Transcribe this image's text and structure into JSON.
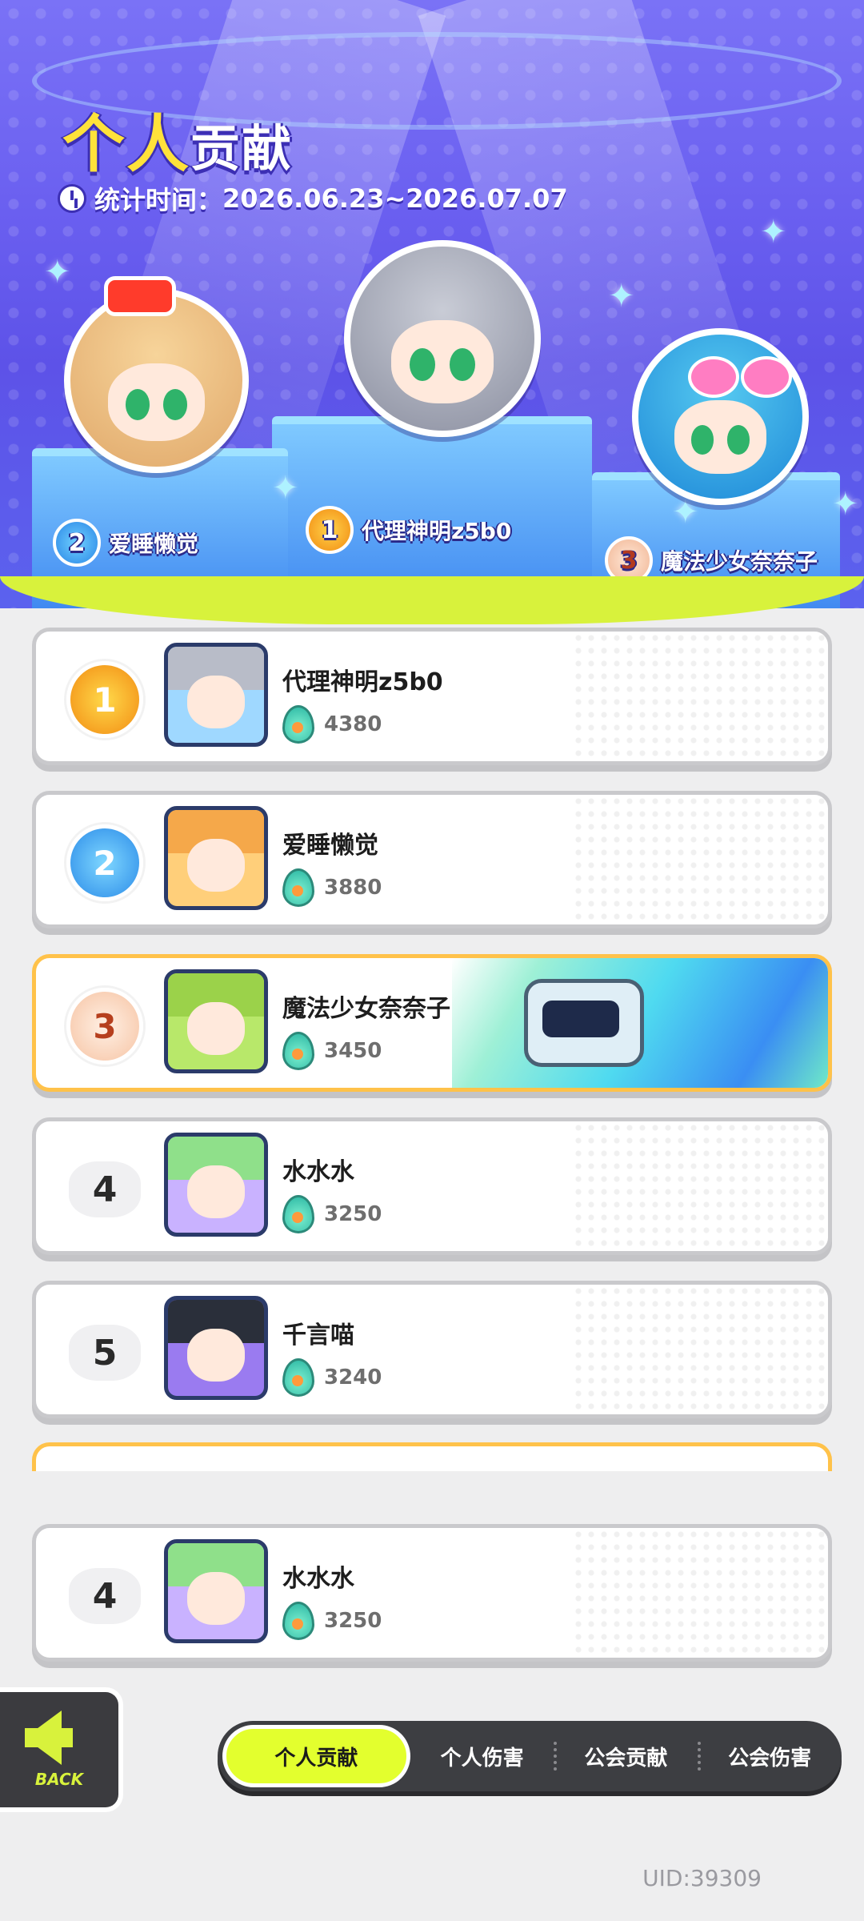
{
  "header": {
    "title_highlight": "个人",
    "title_rest": "贡献",
    "period_label": "统计时间：",
    "period_value": "2026.06.23~2026.07.07"
  },
  "podium": [
    {
      "rank": "1",
      "name": "代理神明z5b0"
    },
    {
      "rank": "2",
      "name": "爱睡懒觉"
    },
    {
      "rank": "3",
      "name": "魔法少女奈奈子"
    }
  ],
  "leaderboard": [
    {
      "rank": "1",
      "name": "代理神明z5b0",
      "score": "4380"
    },
    {
      "rank": "2",
      "name": "爱睡懒觉",
      "score": "3880"
    },
    {
      "rank": "3",
      "name": "魔法少女奈奈子",
      "score": "3450"
    },
    {
      "rank": "4",
      "name": "水水水",
      "score": "3250"
    },
    {
      "rank": "5",
      "name": "千言喵",
      "score": "3240"
    }
  ],
  "my_entry": {
    "rank": "4",
    "name": "水水水",
    "score": "3250"
  },
  "nav": {
    "back_label": "BACK",
    "tabs": [
      "个人贡献",
      "个人伤害",
      "公会贡献",
      "公会伤害"
    ],
    "active_tab": "个人贡献"
  },
  "footer": {
    "uid": "UID:39309"
  },
  "colors": {
    "accent": "#e3ff2e",
    "stage_bg": "#6a5ff0",
    "highlight_border": "#ffc24a"
  }
}
